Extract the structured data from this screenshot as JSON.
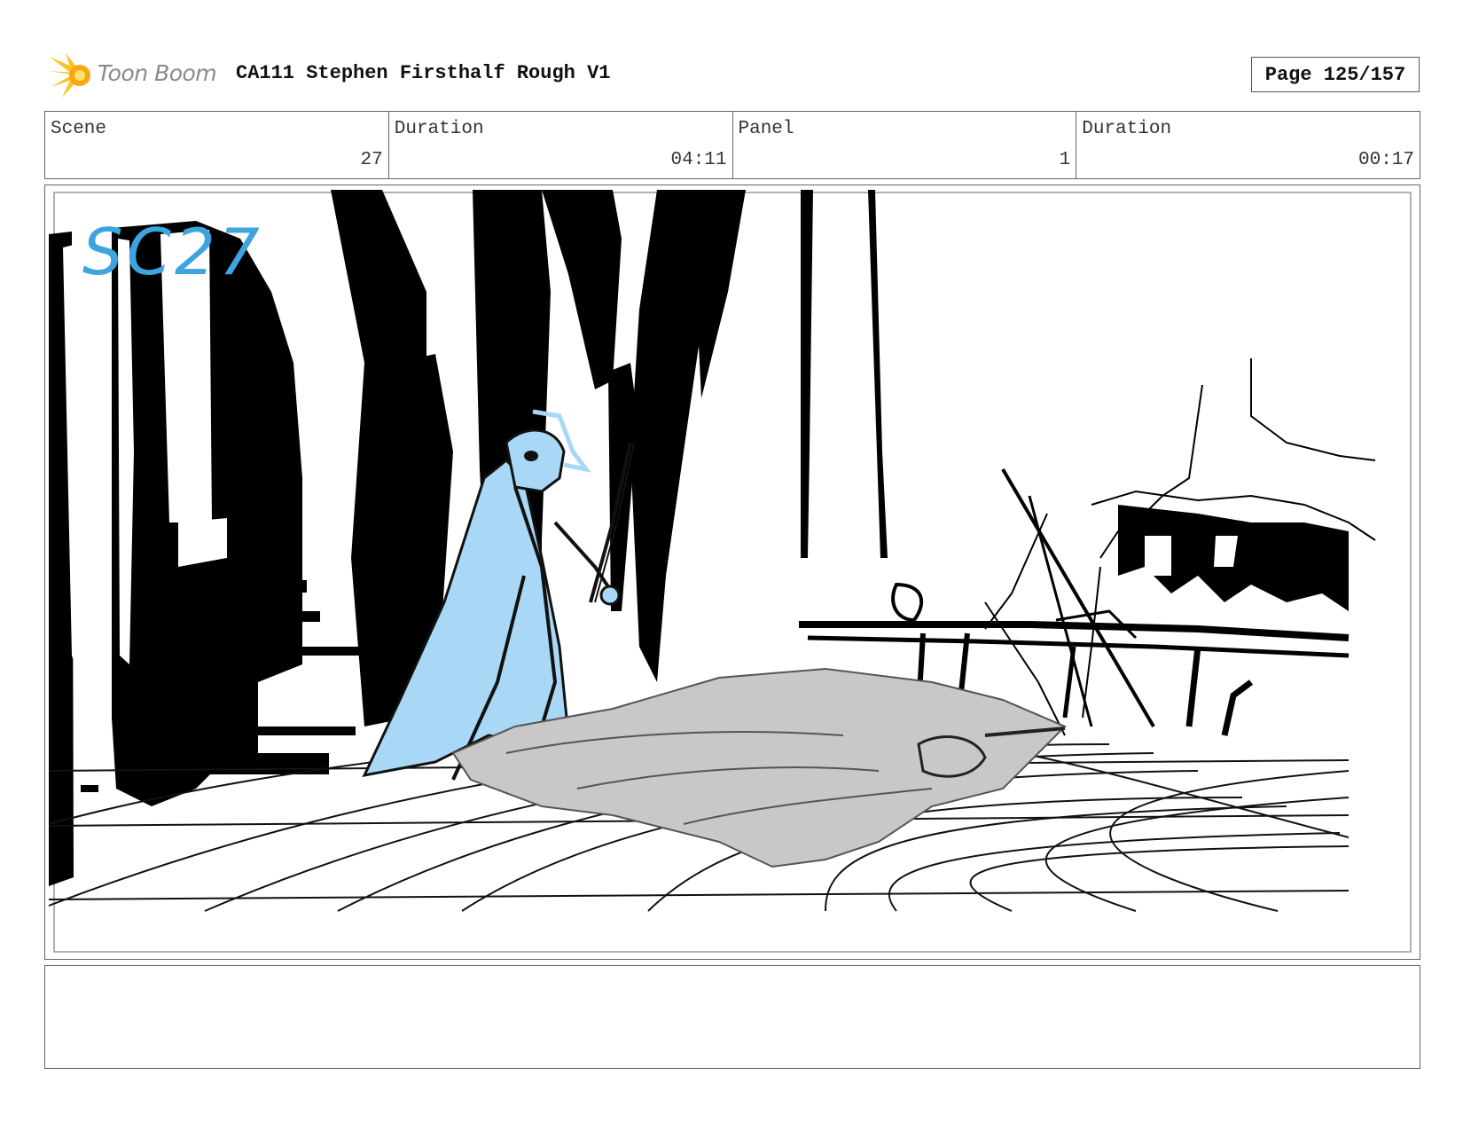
{
  "header": {
    "logo_text": "Toon Boom",
    "title": "CA111 Stephen Firsthalf Rough V1",
    "page_label": "Page 125/157"
  },
  "info": {
    "scene_label": "Scene",
    "scene_value": "27",
    "scene_duration_label": "Duration",
    "scene_duration_value": "04:11",
    "panel_label": "Panel",
    "panel_value": "1",
    "panel_duration_label": "Duration",
    "panel_duration_value": "00:17"
  },
  "panel": {
    "sketch_label": "SC27"
  },
  "colors": {
    "accent_blue": "#a8d8f5",
    "sketch_blue": "#3da4e0",
    "body_gray": "#c8c8c8",
    "logo_yellow": "#f6c324"
  },
  "notes": {
    "text": ""
  }
}
